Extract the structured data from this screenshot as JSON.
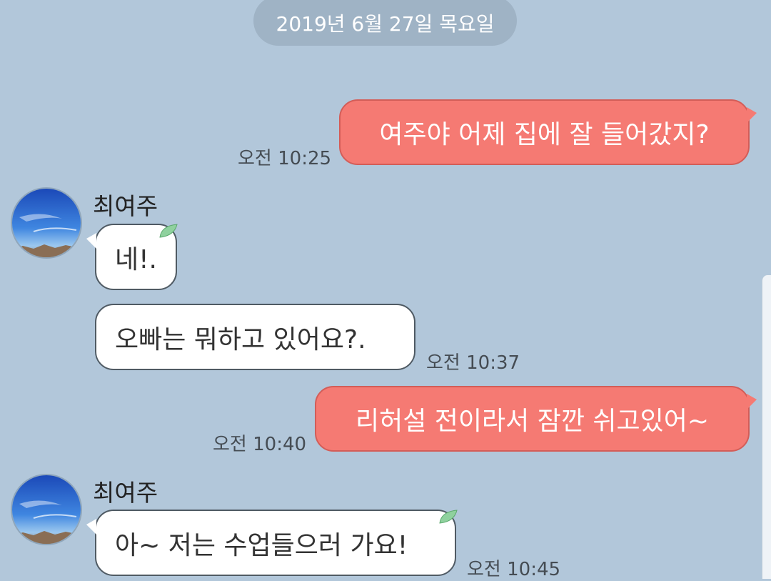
{
  "date_divider": "2019년 6월 27일 목요일",
  "contact": {
    "name": "최여주",
    "avatar_icon": "sky-avatar"
  },
  "colors": {
    "background": "#b2c7da",
    "my_bubble": "#f57a73",
    "their_bubble": "#ffffff",
    "date_pill": "#9fb3c5"
  },
  "messages": [
    {
      "from": "me",
      "text": "여주야 어제 집에 잘 들어갔지?",
      "time": "오전 10:25"
    },
    {
      "from": "them",
      "text": "네!.",
      "time": ""
    },
    {
      "from": "them",
      "text": "오빠는 뭐하고 있어요?.",
      "time": "오전 10:37"
    },
    {
      "from": "me",
      "text": "리허설 전이라서 잠깐 쉬고있어~",
      "time": "오전 10:40"
    },
    {
      "from": "them",
      "text": "아~ 저는 수업들으러 가요!",
      "time": "오전 10:45"
    }
  ]
}
